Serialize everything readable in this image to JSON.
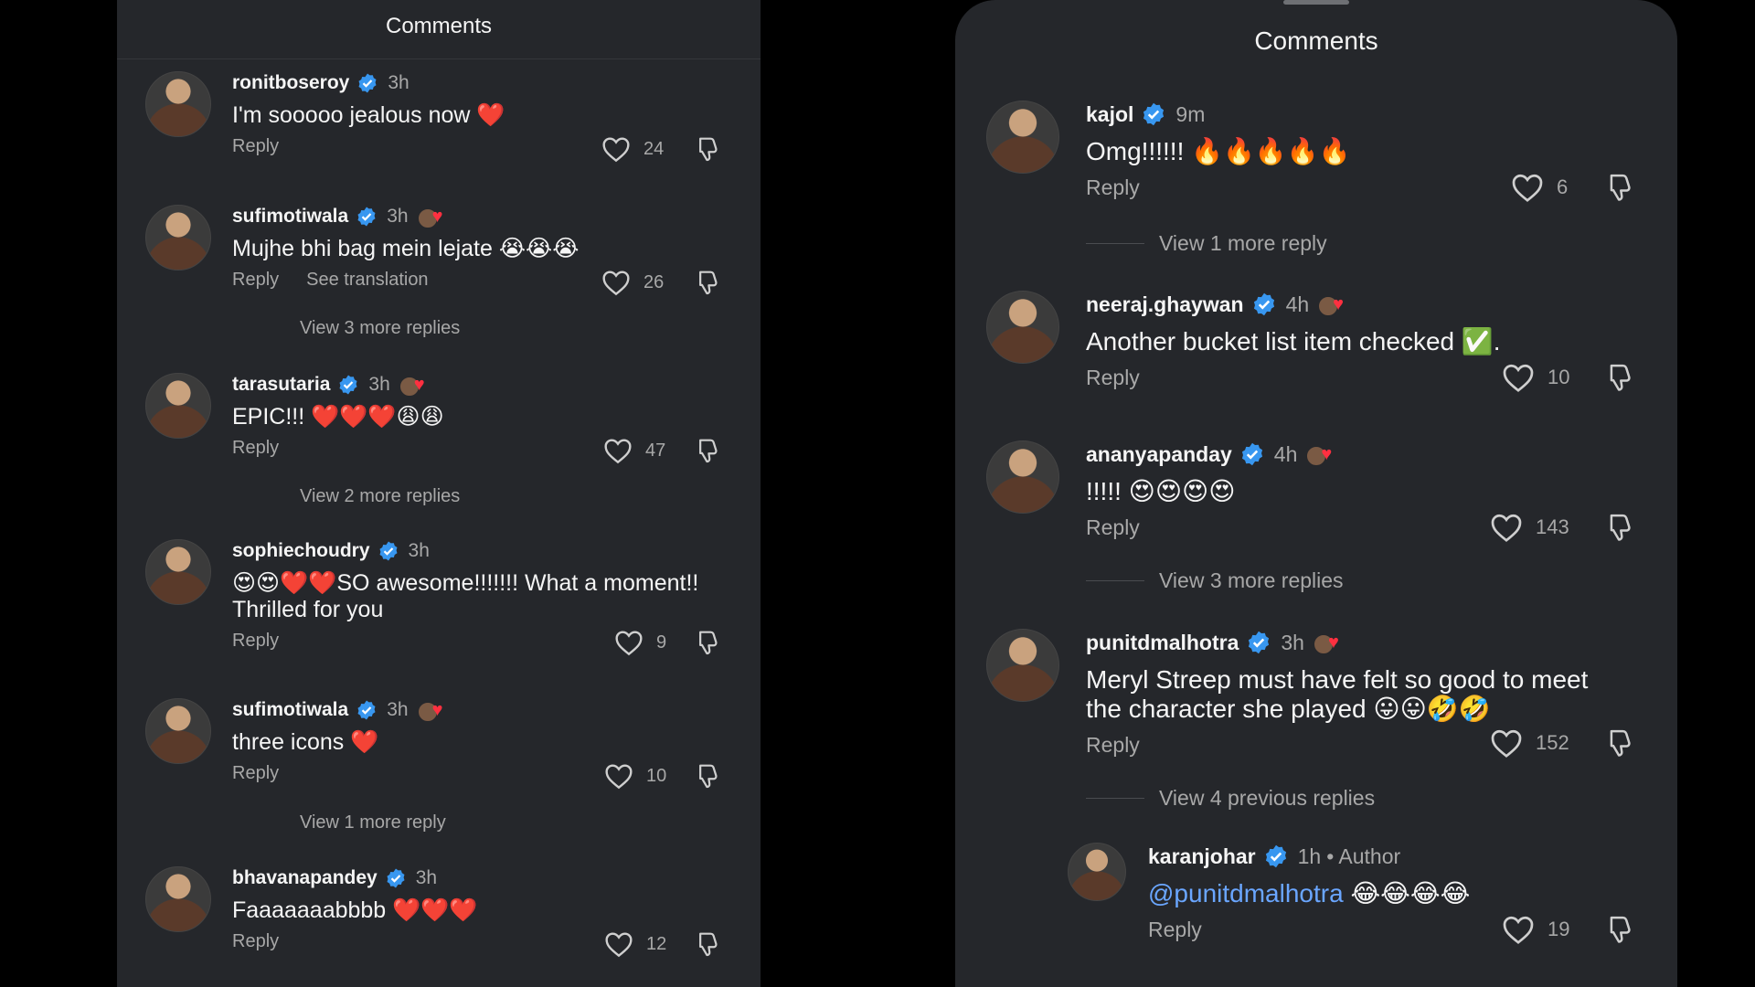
{
  "left": {
    "header": "Comments",
    "comments": [
      {
        "username": "ronitboseroy",
        "time": "3h",
        "text": "I'm sooooo jealous now ❤️",
        "reply": "Reply",
        "likes": "24",
        "liked_by_author": false
      },
      {
        "username": "sufimotiwala",
        "time": "3h",
        "text": "Mujhe bhi bag mein lejate 😭😭😭",
        "reply": "Reply",
        "see_translation": "See translation",
        "likes": "26",
        "liked_by_author": true,
        "more_replies": "View 3 more replies"
      },
      {
        "username": "tarasutaria",
        "time": "3h",
        "text": "EPIC!!! ❤️❤️❤️😩😩",
        "reply": "Reply",
        "likes": "47",
        "liked_by_author": true,
        "more_replies": "View 2 more replies"
      },
      {
        "username": "sophiechoudry",
        "time": "3h",
        "text": "😍😍❤️❤️SO awesome!!!!!!! What a moment!! Thrilled for you",
        "reply": "Reply",
        "likes": "9",
        "liked_by_author": false
      },
      {
        "username": "sufimotiwala",
        "time": "3h",
        "text": "three icons ❤️",
        "reply": "Reply",
        "likes": "10",
        "liked_by_author": true,
        "more_replies": "View 1 more reply"
      },
      {
        "username": "bhavanapandey",
        "time": "3h",
        "text": "Faaaaaaabbbb ❤️❤️❤️",
        "reply": "Reply",
        "likes": "12",
        "liked_by_author": false
      }
    ]
  },
  "right": {
    "header": "Comments",
    "comments": [
      {
        "username": "kajol",
        "time": "9m",
        "text": "Omg!!!!!! 🔥🔥🔥🔥🔥",
        "reply": "Reply",
        "likes": "6",
        "liked_by_author": false,
        "more_replies": "View 1 more reply"
      },
      {
        "username": "neeraj.ghaywan",
        "time": "4h",
        "text": "Another bucket list item checked ✅.",
        "reply": "Reply",
        "likes": "10",
        "liked_by_author": true
      },
      {
        "username": "ananyapanday",
        "time": "4h",
        "text": "!!!!! 😍😍😍😍",
        "reply": "Reply",
        "likes": "143",
        "liked_by_author": true,
        "more_replies": "View 3 more replies"
      },
      {
        "username": "punitdmalhotra",
        "time": "3h",
        "text": "Meryl Streep must have felt so good to meet the character she played 😛😛🤣🤣",
        "reply": "Reply",
        "likes": "152",
        "liked_by_author": true,
        "more_replies": "View 4 previous replies"
      },
      {
        "username": "karanjohar",
        "time": "1h",
        "author_label": "• Author",
        "mention": "@punitdmalhotra",
        "text": "😂😂😂😂",
        "reply": "Reply",
        "likes": "19",
        "liked_by_author": false
      }
    ]
  },
  "colors": {
    "background": "#000000",
    "panel": "#25272b",
    "text": "#f5f5f5",
    "muted": "#a8a8a8",
    "verified": "#3897f0",
    "heart": "#ff3040",
    "mention": "#6aa6ff"
  },
  "icons": {
    "verified": "verified-badge-icon",
    "like": "heart-outline-icon",
    "dislike": "dislike-icon"
  }
}
